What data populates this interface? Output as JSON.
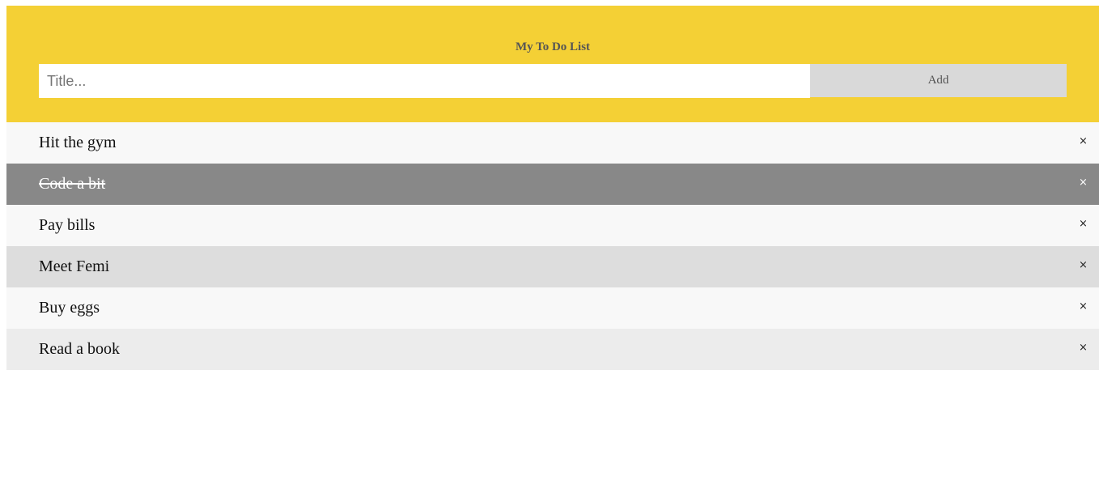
{
  "app": {
    "title": "My To Do List"
  },
  "form": {
    "input_placeholder": "Title...",
    "input_value": "",
    "add_label": "Add"
  },
  "colors": {
    "header_bg": "#f4d035",
    "checked_bg": "#888888",
    "button_bg": "#d9d9d9"
  },
  "todos": [
    {
      "label": "Hit the gym",
      "checked": false,
      "close": "×"
    },
    {
      "label": "Code a bit",
      "checked": true,
      "close": "×"
    },
    {
      "label": "Pay bills",
      "checked": false,
      "close": "×"
    },
    {
      "label": "Meet Femi",
      "checked": false,
      "close": "×"
    },
    {
      "label": "Buy eggs",
      "checked": false,
      "close": "×"
    },
    {
      "label": "Read a book",
      "checked": false,
      "close": "×"
    }
  ]
}
